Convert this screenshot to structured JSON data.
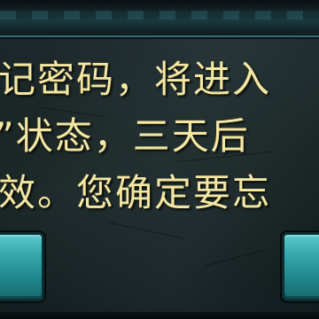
{
  "dialog": {
    "message_lines": [
      "记密码，将进入",
      "”状态，三天后",
      "效。您确定要忘"
    ],
    "buttons": {
      "confirm_label": "",
      "cancel_label": ""
    }
  },
  "colors": {
    "text": "#f3e7a3",
    "button": "#36a9ad",
    "frame": "#1b3a41",
    "panel": "#1a2528"
  }
}
